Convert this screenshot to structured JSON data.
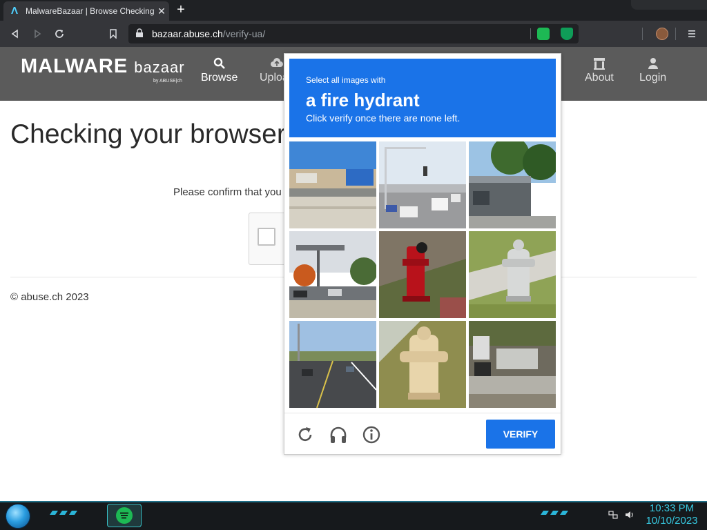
{
  "browser": {
    "tab_title": "MalwareBazaar | Browse Checking",
    "tab_favicon": "Λ",
    "tab_close": "✕",
    "new_tab": "+",
    "url_host": "bazaar.abuse.ch",
    "url_path": "/verify-ua/",
    "icons": [
      "back-icon",
      "forward-icon",
      "reload-icon",
      "bookmark-icon",
      "lock-icon",
      "extension-icon",
      "shield-extension-icon",
      "profile-avatar",
      "menu-icon"
    ]
  },
  "site": {
    "logo_main": "MALWARE",
    "logo_bazaar": "bazaar",
    "logo_sub": "by ABUSE|ch",
    "nav": [
      {
        "label": "Browse",
        "icon": "search-icon"
      },
      {
        "label": "Upload",
        "icon": "cloud-upload-icon"
      },
      {
        "label": "About",
        "icon": "bank-icon"
      },
      {
        "label": "Login",
        "icon": "user-icon"
      }
    ]
  },
  "page": {
    "title": "Checking your browser",
    "confirm_text": "Please confirm that you are a human",
    "footer": "© abuse.ch 2023"
  },
  "captcha": {
    "instruction_line1": "Select all images with",
    "target_object": "a fire hydrant",
    "instruction_line3": "Click verify once there are none left.",
    "verify_label": "VERIFY",
    "tiles": [
      "street-scene-tile",
      "intersection-traffic-tile",
      "building-street-tile",
      "street-corner-tile",
      "red-fire-hydrant-tile",
      "silver-fire-hydrant-tile",
      "road-traffic-tile",
      "yellow-fire-hydrant-tile",
      "parking-lot-tile"
    ],
    "footer_icons": [
      "reload-icon",
      "headphones-audio-icon",
      "info-icon"
    ],
    "colors": {
      "accent": "#1a73e8"
    }
  },
  "taskbar": {
    "time": "10:33 PM",
    "date": "10/10/2023",
    "icons": [
      "start-orb-icon",
      "spotify-icon",
      "network-icon",
      "volume-icon"
    ]
  },
  "colors": {
    "site_header": "#5b5b5b",
    "browser_dark": "#35363a",
    "clock": "#37c8e0"
  }
}
